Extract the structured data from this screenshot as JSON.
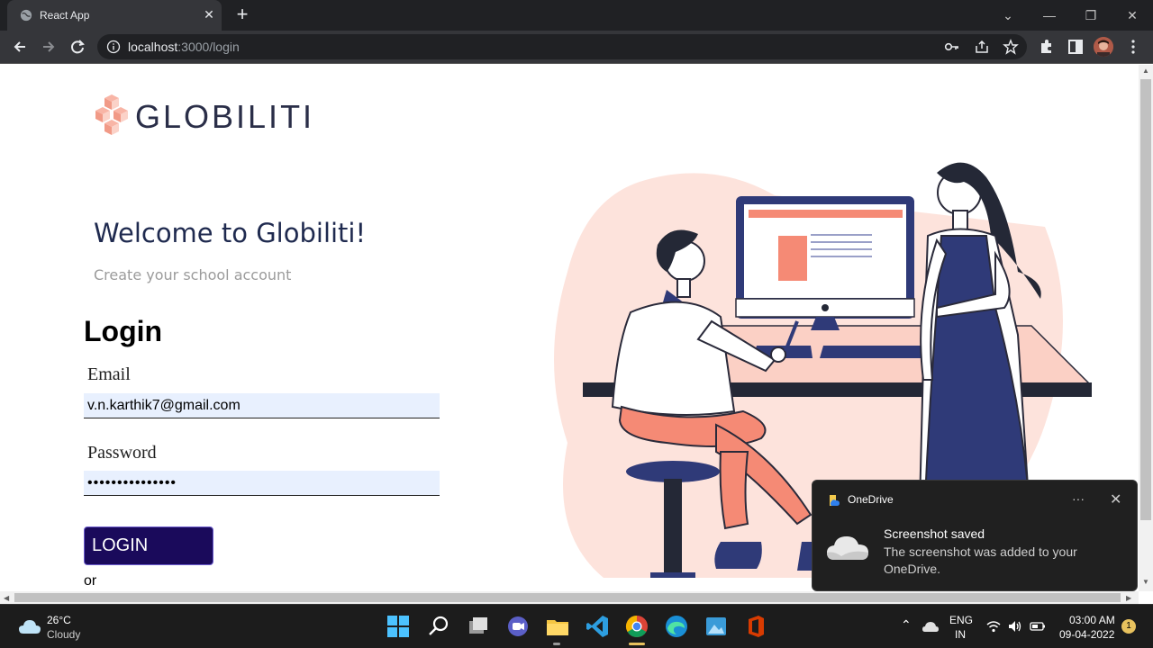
{
  "browser": {
    "tab_title": "React App",
    "tab_close": "✕",
    "new_tab": "+",
    "url_host": "localhost",
    "url_path": ":3000/login",
    "window_controls": {
      "tabsearch": "⌄",
      "minimize": "—",
      "restore": "❐",
      "close": "✕"
    }
  },
  "page": {
    "logo_text": "GLOBILITI",
    "welcome": "Welcome to Globiliti!",
    "subtitle": "Create your school account",
    "login_title": "Login",
    "email_label": "Email",
    "email_value": "v.n.karthik7@gmail.com",
    "password_label": "Password",
    "password_value": "•••••••••••••••",
    "login_button": "LOGIN",
    "or_text": "or"
  },
  "notification": {
    "app": "OneDrive",
    "more": "···",
    "close": "✕",
    "title": "Screenshot saved",
    "body": "The screenshot was added to your OneDrive."
  },
  "taskbar": {
    "temperature": "26°C",
    "weather": "Cloudy",
    "language": "ENG",
    "region": "IN",
    "time": "03:00 AM",
    "date": "09-04-2022",
    "notification_count": "1"
  },
  "colors": {
    "accent_button": "#1a0a5b",
    "heading": "#1f2a4f",
    "logo_text": "#2a2e48",
    "illustration_pink": "#fde3dc",
    "illustration_coral": "#f58a75",
    "illustration_navy": "#2f3a78"
  }
}
